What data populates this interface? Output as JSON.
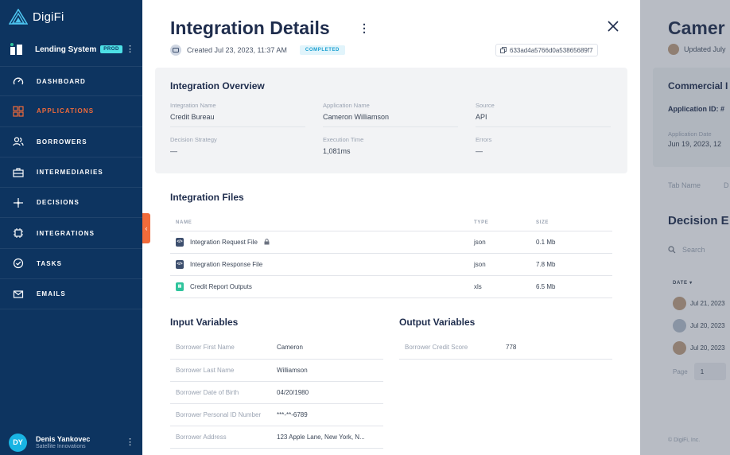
{
  "sidebar": {
    "brand": "DigiFi",
    "system_name": "Lending System",
    "env_badge": "PROD",
    "nav": [
      {
        "label": "DASHBOARD",
        "icon": "gauge-icon",
        "active": false
      },
      {
        "label": "APPLICATIONS",
        "icon": "grid-icon",
        "active": true
      },
      {
        "label": "BORROWERS",
        "icon": "users-icon",
        "active": false
      },
      {
        "label": "INTERMEDIARIES",
        "icon": "briefcase-icon",
        "active": false
      },
      {
        "label": "DECISIONS",
        "icon": "flow-icon",
        "active": false
      },
      {
        "label": "INTEGRATIONS",
        "icon": "chip-icon",
        "active": false
      },
      {
        "label": "TASKS",
        "icon": "check-circle-icon",
        "active": false
      },
      {
        "label": "EMAILS",
        "icon": "mail-icon",
        "active": false
      }
    ],
    "user": {
      "initials": "DY",
      "name": "Denis Yankovec",
      "org": "Satellite Innovations"
    }
  },
  "drawer": {
    "title": "Integration Details",
    "created": "Created Jul 23, 2023, 11:37 AM",
    "status": "COMPLETED",
    "id": "633ad4a5766d0a53865689f7",
    "overview": {
      "heading": "Integration Overview",
      "fields": [
        {
          "label": "Integration Name",
          "value": "Credit Bureau"
        },
        {
          "label": "Application Name",
          "value": "Cameron Williamson"
        },
        {
          "label": "Source",
          "value": "API"
        },
        {
          "label": "Decision Strategy",
          "value": "—"
        },
        {
          "label": "Execution Time",
          "value": "1,081ms"
        },
        {
          "label": "Errors",
          "value": "—"
        }
      ]
    },
    "files": {
      "heading": "Integration Files",
      "columns": [
        "NAME",
        "TYPE",
        "SIZE"
      ],
      "rows": [
        {
          "name": "Integration Request File",
          "type": "json",
          "size": "0.1 Mb",
          "icon": "code-file-icon",
          "locked": true
        },
        {
          "name": "Integration Response File",
          "type": "json",
          "size": "7.8 Mb",
          "icon": "code-file-icon",
          "locked": false
        },
        {
          "name": "Credit Report Outputs",
          "type": "xls",
          "size": "6.5 Mb",
          "icon": "spreadsheet-icon",
          "locked": false
        }
      ]
    },
    "input_variables": {
      "heading": "Input Variables",
      "rows": [
        {
          "key": "Borrower First Name",
          "value": "Cameron"
        },
        {
          "key": "Borrower Last Name",
          "value": "Williamson"
        },
        {
          "key": "Borrower Date of Birth",
          "value": "04/20/1980"
        },
        {
          "key": "Borrower Personal ID Number",
          "value": "***-**-6789"
        },
        {
          "key": "Borrower Address",
          "value": "123 Apple Lane, New York, N..."
        }
      ]
    },
    "output_variables": {
      "heading": "Output Variables",
      "rows": [
        {
          "key": "Borrower Credit Score",
          "value": "778"
        }
      ]
    }
  },
  "background_page": {
    "title": "Camer",
    "updated": "Updated July",
    "card_title": "Commercial I",
    "application_id": "Application ID: #",
    "application_date_label": "Application Date",
    "application_date": "Jun 19, 2023, 12",
    "tab_name": "Tab Name",
    "tab_second": "D",
    "decision_heading": "Decision E",
    "search_placeholder": "Search",
    "date_column": "DATE",
    "rows": [
      "Jul 21, 2023",
      "Jul 20, 2023",
      "Jul 20, 2023"
    ],
    "page_label": "Page",
    "page_value": "1",
    "footer": "© DigiFi, Inc."
  },
  "colors": {
    "sidebar": "#0d3460",
    "accent": "#f26b3a",
    "badge": "#4de0e6",
    "status": "#1a9fd0"
  }
}
